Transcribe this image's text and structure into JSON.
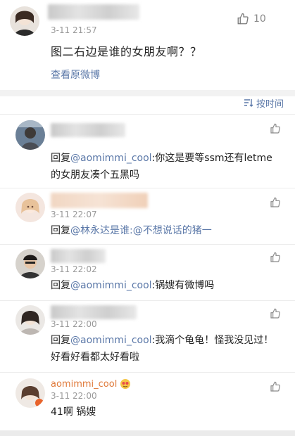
{
  "post": {
    "time": "3-11 21:57",
    "like_count": "10",
    "text": "图二右边是谁的女朋友啊？？",
    "view_original": "查看原微博"
  },
  "sort": {
    "label": "按时间"
  },
  "comments": [
    {
      "time": "",
      "prefix": "回复",
      "mention": "@aomimmi_cool",
      "text": ":你这是要等ssm还有letme的女朋友凑个五黑吗"
    },
    {
      "time": "3-11 22:07",
      "prefix": "回复",
      "mention": "@林永达是谁",
      "text": ":@不想说话的猪一"
    },
    {
      "time": "3-11 22:02",
      "prefix": "回复",
      "mention": "@aomimmi_cool",
      "text": ":锅嫂有微博吗"
    },
    {
      "time": "3-11 22:00",
      "prefix": "回复",
      "mention": "@aomimmi_cool",
      "text": ":我滴个龟龟！怪我没见过！好看好看都太好看啦"
    },
    {
      "name": "aomimmi_cool",
      "time": "3-11 22:00",
      "text": "41啊 锅嫂"
    }
  ]
}
